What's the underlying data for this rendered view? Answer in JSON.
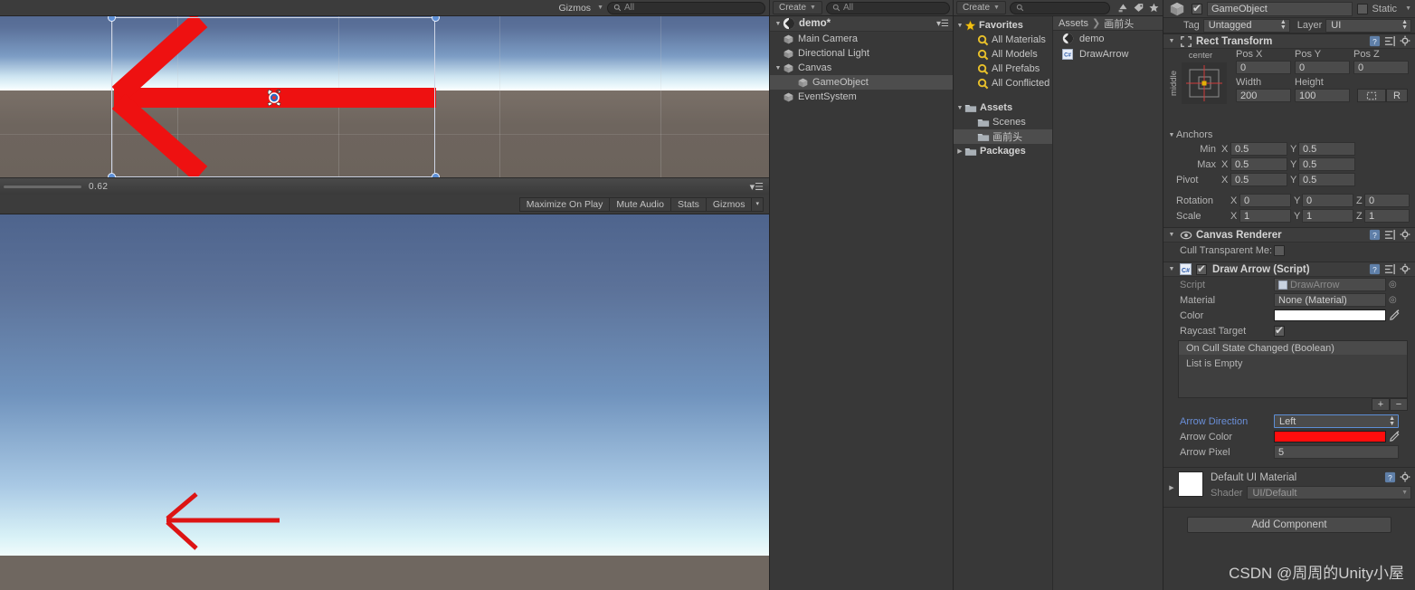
{
  "scene_view": {
    "gizmos_label": "Gizmos",
    "search_placeholder": "All",
    "scale_value": "0.62",
    "menu_icon": "hamburger-icon"
  },
  "game_view": {
    "buttons": [
      "Maximize On Play",
      "Mute Audio",
      "Stats",
      "Gizmos"
    ],
    "gizmos_dropdown": "▾"
  },
  "hierarchy": {
    "create_label": "Create",
    "search_placeholder": "All",
    "scene_name": "demo*",
    "items": [
      {
        "label": "Main Camera",
        "depth": 1,
        "expandable": false,
        "selected": false
      },
      {
        "label": "Directional Light",
        "depth": 1,
        "expandable": false,
        "selected": false
      },
      {
        "label": "Canvas",
        "depth": 1,
        "expandable": true,
        "selected": false
      },
      {
        "label": "GameObject",
        "depth": 2,
        "expandable": false,
        "selected": true
      },
      {
        "label": "EventSystem",
        "depth": 1,
        "expandable": false,
        "selected": false
      }
    ]
  },
  "project": {
    "create_label": "Create",
    "search_placeholder": "",
    "tree": [
      {
        "label": "Favorites",
        "icon": "star-icon",
        "depth": 0,
        "expandable": true,
        "bold": true,
        "selected": false
      },
      {
        "label": "All Materials",
        "icon": "magnifier-icon",
        "depth": 1,
        "expandable": false,
        "bold": false,
        "selected": false
      },
      {
        "label": "All Models",
        "icon": "magnifier-icon",
        "depth": 1,
        "expandable": false,
        "bold": false,
        "selected": false
      },
      {
        "label": "All Prefabs",
        "icon": "magnifier-icon",
        "depth": 1,
        "expandable": false,
        "bold": false,
        "selected": false
      },
      {
        "label": "All Conflicted",
        "icon": "magnifier-icon",
        "depth": 1,
        "expandable": false,
        "bold": false,
        "selected": false
      },
      {
        "label": "",
        "icon": "spacer",
        "depth": 0,
        "expandable": false,
        "bold": false,
        "selected": false
      },
      {
        "label": "Assets",
        "icon": "folder-icon",
        "depth": 0,
        "expandable": true,
        "bold": true,
        "selected": false
      },
      {
        "label": "Scenes",
        "icon": "folder-icon",
        "depth": 1,
        "expandable": false,
        "bold": false,
        "selected": false
      },
      {
        "label": "画前头",
        "icon": "folder-icon",
        "depth": 1,
        "expandable": false,
        "bold": false,
        "selected": true
      },
      {
        "label": "Packages",
        "icon": "folder-icon",
        "depth": 0,
        "expandable": true,
        "bold": true,
        "selected": false
      }
    ],
    "breadcrumb": [
      "Assets",
      "画前头"
    ],
    "assets": [
      {
        "label": "demo",
        "icon": "unity-scene-icon"
      },
      {
        "label": "DrawArrow",
        "icon": "csharp-script-icon"
      }
    ]
  },
  "inspector": {
    "object_name": "GameObject",
    "object_enabled": true,
    "static_label": "Static",
    "tag_label": "Tag",
    "tag_value": "Untagged",
    "layer_label": "Layer",
    "layer_value": "UI",
    "rect_transform": {
      "title": "Rect Transform",
      "anchor_preset_h": "center",
      "anchor_preset_v": "middle",
      "pos_x_label": "Pos X",
      "pos_x": "0",
      "pos_y_label": "Pos Y",
      "pos_y": "0",
      "pos_z_label": "Pos Z",
      "pos_z": "0",
      "width_label": "Width",
      "width": "200",
      "height_label": "Height",
      "height": "100",
      "blueprint_label": "",
      "raw_label": "R",
      "anchors_label": "Anchors",
      "min_label": "Min",
      "min_x": "0.5",
      "min_y": "0.5",
      "max_label": "Max",
      "max_x": "0.5",
      "max_y": "0.5",
      "pivot_label": "Pivot",
      "pivot_x": "0.5",
      "pivot_y": "0.5",
      "rotation_label": "Rotation",
      "rot_x": "0",
      "rot_y": "0",
      "rot_z": "0",
      "scale_label": "Scale",
      "scale_x": "1",
      "scale_y": "1",
      "scale_z": "1",
      "axis_x": "X",
      "axis_y": "Y",
      "axis_z": "Z"
    },
    "canvas_renderer": {
      "title": "Canvas Renderer",
      "cull_label": "Cull Transparent Me:",
      "cull_checked": false
    },
    "draw_arrow": {
      "title": "Draw Arrow (Script)",
      "enabled": true,
      "script_label": "Script",
      "script_value": "DrawArrow",
      "material_label": "Material",
      "material_value": "None (Material)",
      "color_label": "Color",
      "color_value": "#ffffff",
      "raycast_label": "Raycast Target",
      "raycast_checked": true,
      "event_header": "On Cull State Changed (Boolean)",
      "event_empty": "List is Empty",
      "add_btn": "+",
      "remove_btn": "−",
      "arrow_direction_label": "Arrow Direction",
      "arrow_direction_value": "Left",
      "arrow_color_label": "Arrow Color",
      "arrow_color_value": "#ff0d0d",
      "arrow_pixel_label": "Arrow Pixel",
      "arrow_pixel_value": "5"
    },
    "material": {
      "title": "Default UI Material",
      "shader_label": "Shader",
      "shader_value": "UI/Default"
    },
    "add_component_label": "Add Component"
  },
  "watermark": "CSDN @周周的Unity小屋",
  "colors": {
    "accent_blue": "#5d8fd6",
    "arrow_red": "#ee1111",
    "panel_bg": "#383838",
    "toolbar_bg": "#3c3c3c",
    "selection": "#4d4d4d",
    "label_blue": "#6a8fd8"
  }
}
